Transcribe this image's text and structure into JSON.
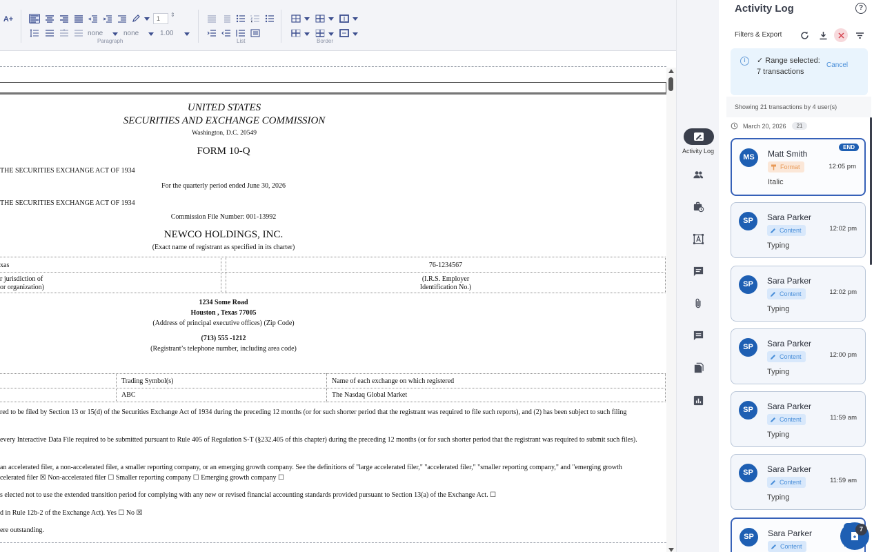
{
  "toolbar": {
    "font_grow_label": "A+",
    "spin_value": "1",
    "border_style_1": "none",
    "border_style_2": "none",
    "line_spacing": "1.00",
    "group_paragraph": "Paragraph",
    "group_list": "List",
    "group_border": "Border"
  },
  "document": {
    "header_line1": "UNITED STATES",
    "header_line2": "SECURITIES AND EXCHANGE COMMISSION",
    "header_line3": "Washington, D.C. 20549",
    "form_title": "FORM 10-Q",
    "act_line_1": "THE SECURITIES EXCHANGE ACT OF 1934",
    "quarterly_period": "For the quarterly period ended June 30, 2026",
    "act_line_2": "THE SECURITIES EXCHANGE ACT OF 1934",
    "commission_file": "Commission File Number: 001-13992",
    "company_name": "NEWCO HOLDINGS, INC.",
    "company_caption": "(Exact name of registrant as specified in its charter)",
    "state_value": "xas",
    "ein_value": "76-1234567",
    "state_caption_1": "r jurisdiction of",
    "state_caption_2": "or organization)",
    "ein_caption_1": "(I.R.S. Employer",
    "ein_caption_2": "Identification No.)",
    "address_1": "1234 Some Road",
    "address_2": "Houston , Texas   77005",
    "address_caption": "(Address of principal executive offices) (Zip Code)",
    "phone": "(713)   555 -1212",
    "phone_caption": "(Registrant’s telephone number, including area code)",
    "trading_symbol_header": "Trading Symbol(s)",
    "exchange_header": "Name of each exchange on which registered",
    "trading_symbol": "ABC",
    "exchange_name": "The Nasdaq Global Market",
    "para_1": "red to be filed by Section 13 or 15(d) of the Securities Exchange Act of 1934 during the preceding 12 months (or for such shorter period that the registrant was required to file such reports), and (2) has been subject to such filing",
    "para_2": "every Interactive Data File required to be submitted pursuant to Rule 405 of Regulation S-T (§232.405 of this chapter) during the preceding 12 months (or for such shorter period that the registrant was required to submit such files).",
    "para_3": "an accelerated filer, a non-accelerated filer, a smaller reporting company, or an emerging growth company. See the definitions of \"large accelerated filer,\" \"accelerated filer,\" \"smaller reporting company,\" and \"emerging growth",
    "para_4": "celerated filer  ☒  Non-accelerated filer   ☐ Smaller reporting company ☐ Emerging growth company ☐",
    "para_5": "s elected not to use the extended transition period for complying with any new or revised financial accounting standards provided pursuant to Section 13(a) of the Exchange Act. ☐",
    "para_6": "d in Rule 12b-2 of the Exchange Act). Yes ☐  No   ☒",
    "para_7": "ere outstanding."
  },
  "rail": {
    "active_label": "Activity Log"
  },
  "panel": {
    "title": "Activity Log",
    "help": "?",
    "filters_label": "Filters & Export",
    "banner_text": "✓ Range selected: 7 transactions",
    "banner_cancel": "Cancel",
    "showing": "Showing 21 transactions by 4 user(s)",
    "date": "March 20, 2026",
    "date_count": "21",
    "entries": [
      {
        "initials": "MS",
        "name": "Matt Smith",
        "chip": "Format",
        "time": "12:05 pm",
        "action": "Italic",
        "badge": "END"
      },
      {
        "initials": "SP",
        "name": "Sara Parker",
        "chip": "Content",
        "time": "12:02 pm",
        "action": "Typing"
      },
      {
        "initials": "SP",
        "name": "Sara Parker",
        "chip": "Content",
        "time": "12:02 pm",
        "action": "Typing"
      },
      {
        "initials": "SP",
        "name": "Sara Parker",
        "chip": "Content",
        "time": "12:00 pm",
        "action": "Typing"
      },
      {
        "initials": "SP",
        "name": "Sara Parker",
        "chip": "Content",
        "time": "11:59 am",
        "action": "Typing"
      },
      {
        "initials": "SP",
        "name": "Sara Parker",
        "chip": "Content",
        "time": "11:59 am",
        "action": "Typing"
      },
      {
        "initials": "SP",
        "name": "Sara Parker",
        "chip": "Content",
        "time": "11:5",
        "action": "",
        "badge": "ST"
      }
    ],
    "fab_badge": "7"
  },
  "colors": {
    "accent": "#1e5fb3",
    "toolbar_icon": "#3d4f8f",
    "rail_active": "#3a3f4c",
    "content_chip": "#4a8fd9",
    "format_chip": "#e89a58"
  }
}
